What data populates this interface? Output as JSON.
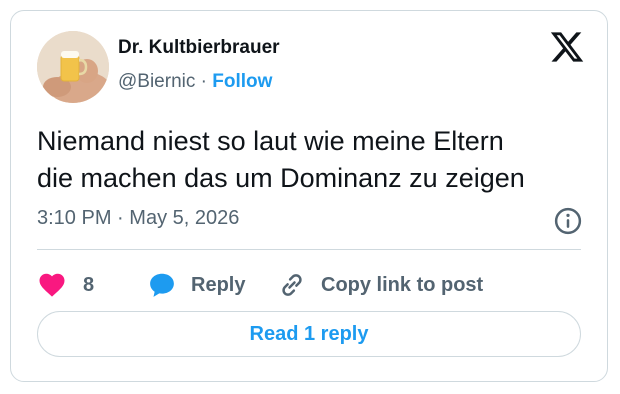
{
  "author": {
    "name": "Dr. Kultbierbrauer",
    "handle": "@Biernic",
    "separator": "·",
    "follow_label": "Follow"
  },
  "tweet": {
    "line1": "Niemand niest so laut wie meine Eltern",
    "line2": "die machen das um Dominanz zu zeigen",
    "time": "3:10 PM",
    "meta_separator": "·",
    "date": "May 5, 2026"
  },
  "actions": {
    "like_count": "8",
    "reply_label": "Reply",
    "copy_label": "Copy link to post"
  },
  "read_reply_label": "Read 1 reply",
  "colors": {
    "accent": "#1d9bf0",
    "heart": "#f91880",
    "muted": "#536471",
    "border": "#cfd9de"
  },
  "icons": [
    "x-logo-icon",
    "info-icon",
    "heart-icon",
    "reply-bubble-icon",
    "link-icon"
  ]
}
